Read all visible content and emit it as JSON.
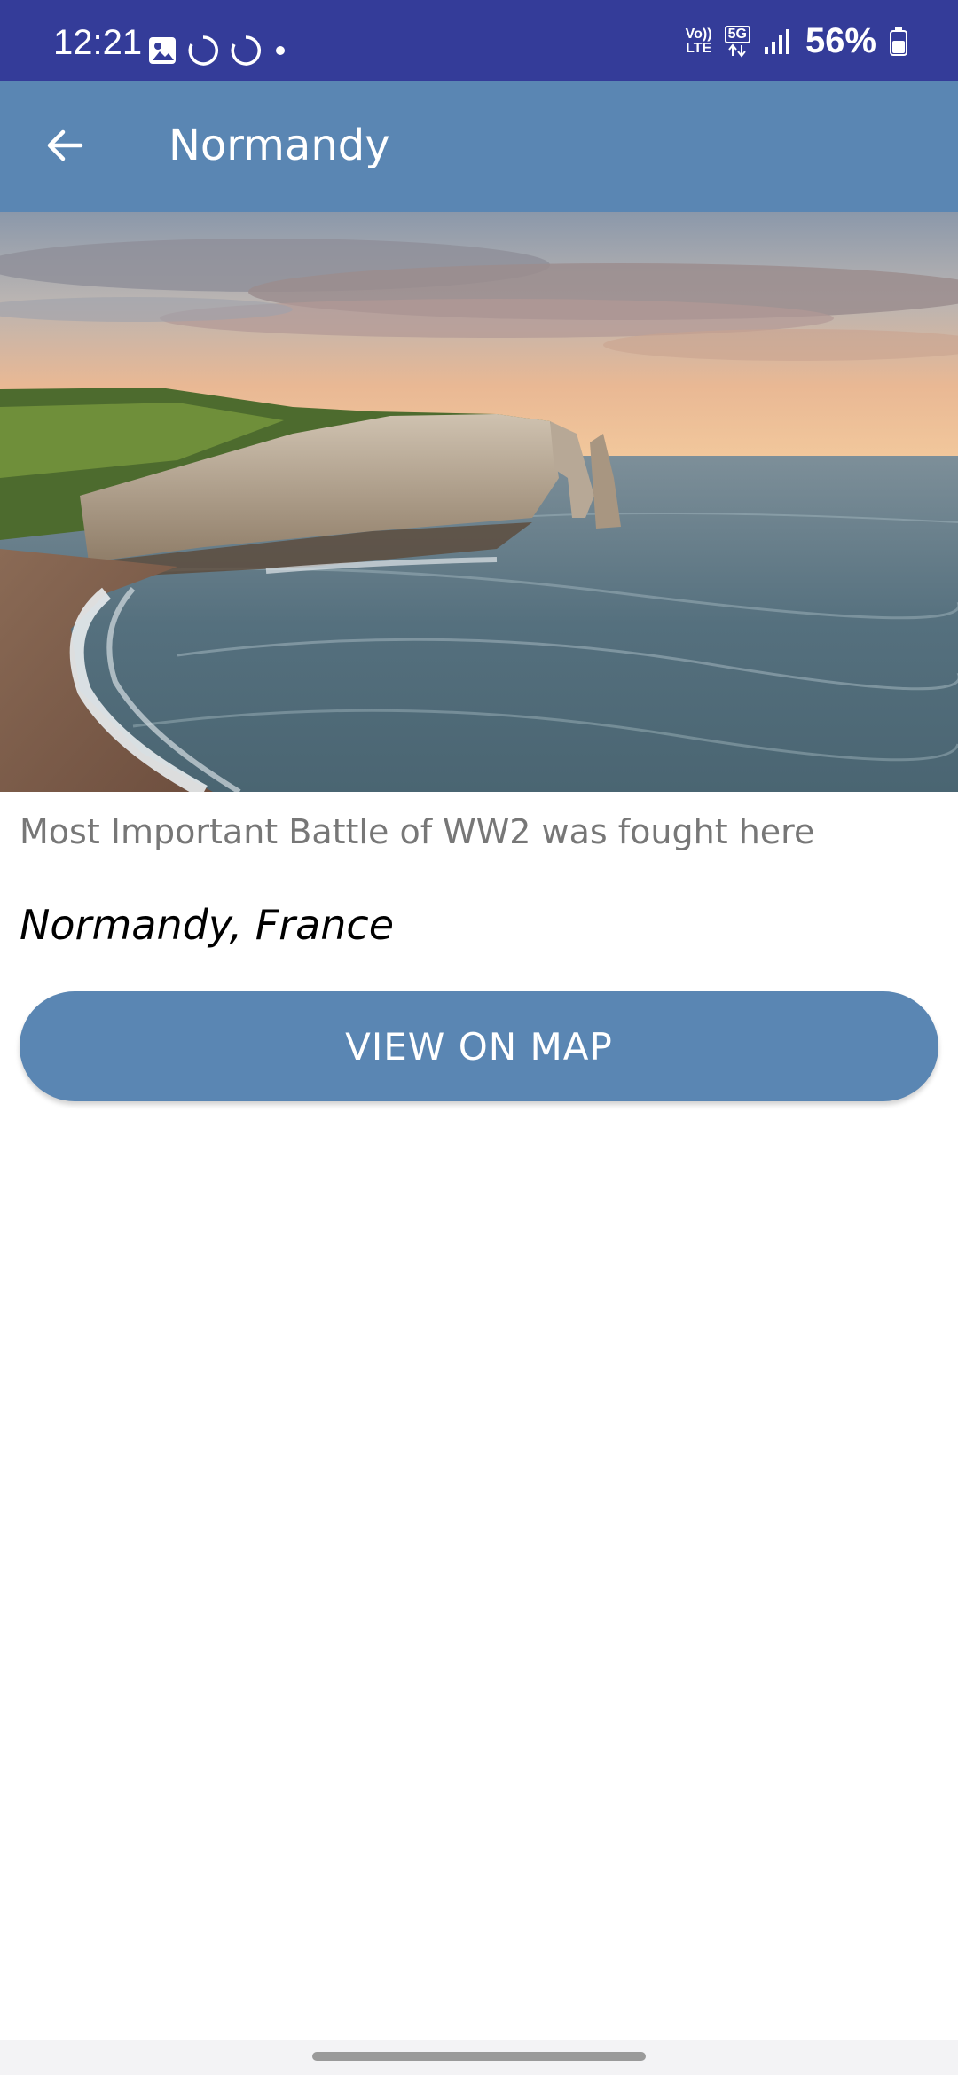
{
  "status_bar": {
    "time": "12:21",
    "battery": "56%",
    "volte_label_top": "Vo))",
    "volte_label_bottom": "LTE",
    "network": "5G",
    "background": "#343c99",
    "icons": [
      "image-icon",
      "sync-icon",
      "sync-icon",
      "dot-icon",
      "volte-icon",
      "5g-icon",
      "signal-icon",
      "battery-icon"
    ]
  },
  "app_bar": {
    "title": "Normandy",
    "background": "#5a86b3",
    "back_icon": "arrow-left-icon"
  },
  "hero_image": {
    "subject": "etretat-cliffs-coastline-image"
  },
  "details": {
    "description": "Most Important Battle of WW2 was fought here",
    "location": "Normandy, France"
  },
  "actions": {
    "view_on_map": "VIEW ON MAP",
    "button_color": "#5a86b3"
  }
}
